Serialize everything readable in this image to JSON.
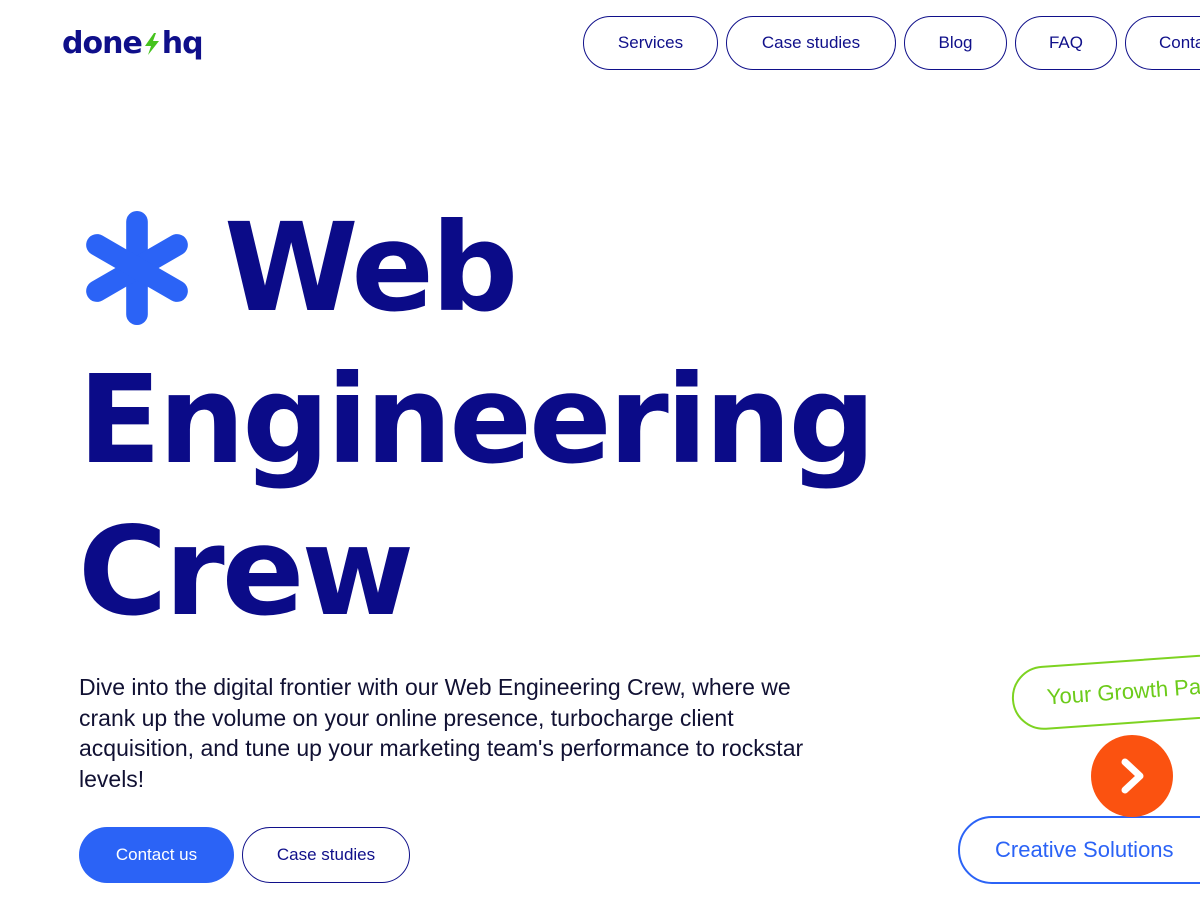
{
  "logo": {
    "text_left": "done",
    "text_right": "hq",
    "bolt_color": "#46c31e",
    "text_color": "#0f0f8a"
  },
  "nav": {
    "items": [
      {
        "label": "Services"
      },
      {
        "label": "Case studies"
      },
      {
        "label": "Blog"
      },
      {
        "label": "FAQ"
      },
      {
        "label": "Conta"
      }
    ]
  },
  "hero": {
    "icon": "asterisk-icon",
    "title_line1": "Web",
    "title_line2": "Engineering",
    "title_line3": "Crew",
    "description": "Dive into the digital frontier with our Web Engineering Crew, where we crank up the volume on your online presence, turbocharge client acquisition, and tune up your marketing team's performance to rockstar levels!",
    "primary_cta": "Contact us",
    "secondary_cta": "Case studies"
  },
  "floating": {
    "growth_tag": "Your Growth Pa",
    "creative_tag": "Creative Solutions",
    "arrow_icon": "chevron-right-icon"
  },
  "colors": {
    "navy": "#0b0b88",
    "blue": "#2b63f6",
    "green": "#7dd321",
    "orange": "#fb5210"
  }
}
